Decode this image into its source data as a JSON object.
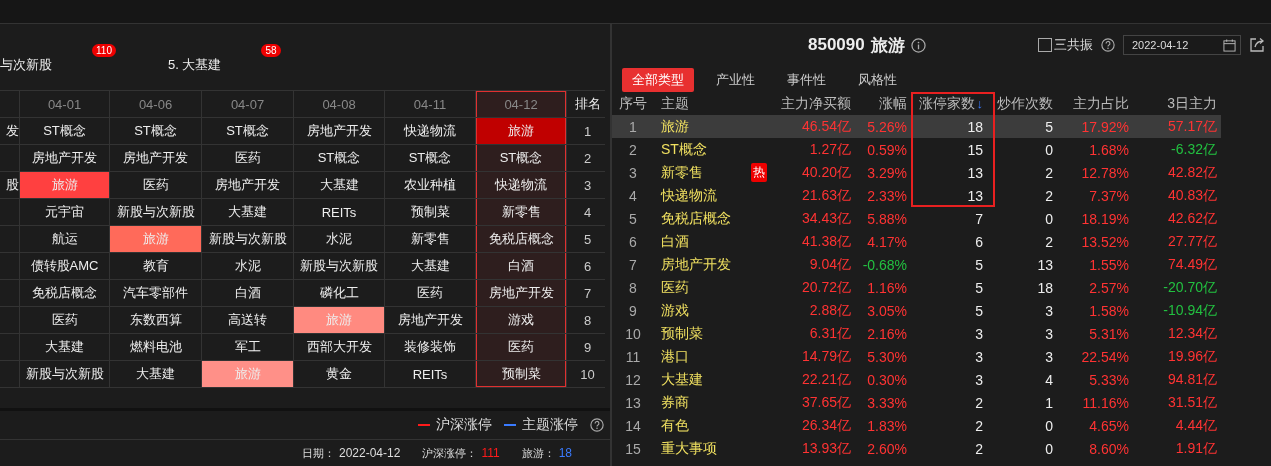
{
  "top_labels": [
    {
      "text": "与次新股",
      "badge": "110"
    },
    {
      "text": "5. 大基建",
      "badge": "58"
    }
  ],
  "history": {
    "columns": [
      {
        "label": "04-01",
        "selected": false
      },
      {
        "label": "04-06",
        "selected": false
      },
      {
        "label": "04-07",
        "selected": false
      },
      {
        "label": "04-08",
        "selected": false
      },
      {
        "label": "04-11",
        "selected": false
      },
      {
        "label": "04-12",
        "selected": true
      }
    ],
    "rank_header": "排名",
    "rows": [
      {
        "cut": "发",
        "rank": "1",
        "cells": [
          {
            "text": "ST概念"
          },
          {
            "text": "ST概念"
          },
          {
            "text": "ST概念"
          },
          {
            "text": "房地产开发"
          },
          {
            "text": "快递物流"
          },
          {
            "text": "旅游",
            "color": "#c00000"
          }
        ]
      },
      {
        "rank": "2",
        "cells": [
          {
            "text": "房地产开发"
          },
          {
            "text": "房地产开发"
          },
          {
            "text": "医药"
          },
          {
            "text": "ST概念"
          },
          {
            "text": "ST概念"
          },
          {
            "text": "ST概念"
          }
        ]
      },
      {
        "cut": "股",
        "rank": "3",
        "cells": [
          {
            "text": "旅游",
            "color": "#ff4040"
          },
          {
            "text": "医药"
          },
          {
            "text": "房地产开发"
          },
          {
            "text": "大基建"
          },
          {
            "text": "农业种植"
          },
          {
            "text": "快递物流"
          }
        ]
      },
      {
        "rank": "4",
        "cells": [
          {
            "text": "元宇宙"
          },
          {
            "text": "新股与次新股"
          },
          {
            "text": "大基建"
          },
          {
            "text": "REITs"
          },
          {
            "text": "预制菜"
          },
          {
            "text": "新零售"
          }
        ]
      },
      {
        "rank": "5",
        "cells": [
          {
            "text": "航运"
          },
          {
            "text": "旅游",
            "color": "#ff6a5a"
          },
          {
            "text": "新股与次新股"
          },
          {
            "text": "水泥"
          },
          {
            "text": "新零售"
          },
          {
            "text": "免税店概念"
          }
        ]
      },
      {
        "rank": "6",
        "cells": [
          {
            "text": "债转股AMC"
          },
          {
            "text": "教育"
          },
          {
            "text": "水泥"
          },
          {
            "text": "新股与次新股"
          },
          {
            "text": "大基建"
          },
          {
            "text": "白酒"
          }
        ]
      },
      {
        "rank": "7",
        "cells": [
          {
            "text": "免税店概念"
          },
          {
            "text": "汽车零部件"
          },
          {
            "text": "白酒"
          },
          {
            "text": "磷化工"
          },
          {
            "text": "医药"
          },
          {
            "text": "房地产开发"
          }
        ]
      },
      {
        "rank": "8",
        "cells": [
          {
            "text": "医药"
          },
          {
            "text": "东数西算"
          },
          {
            "text": "高送转"
          },
          {
            "text": "旅游",
            "color": "#ff8a80"
          },
          {
            "text": "房地产开发"
          },
          {
            "text": "游戏"
          }
        ]
      },
      {
        "rank": "9",
        "cells": [
          {
            "text": "大基建"
          },
          {
            "text": "燃料电池"
          },
          {
            "text": "军工"
          },
          {
            "text": "西部大开发"
          },
          {
            "text": "装修装饰"
          },
          {
            "text": "医药"
          }
        ]
      },
      {
        "rank": "10",
        "cells": [
          {
            "text": "新股与次新股"
          },
          {
            "text": "大基建"
          },
          {
            "text": "旅游",
            "color": "#ff9088"
          },
          {
            "text": "黄金"
          },
          {
            "text": "REITs"
          },
          {
            "text": "预制菜"
          }
        ]
      }
    ]
  },
  "legend": [
    {
      "label": "沪深涨停",
      "color": "#ff1a1a"
    },
    {
      "label": "主题涨停",
      "color": "#3a7bff"
    }
  ],
  "footer": [
    {
      "label": "日期：",
      "value": "2022-04-12",
      "color": "#dddddd"
    },
    {
      "label": "沪深涨停：",
      "value": "111",
      "color": "#ff1a1a"
    },
    {
      "label": "旅游：",
      "value": "18",
      "color": "#3a7bff"
    }
  ],
  "title": {
    "code": "850090",
    "name": "旅游"
  },
  "resonance": {
    "label": "三共振",
    "checked": false
  },
  "date_field": {
    "value": "2022-04-12"
  },
  "tabs": [
    {
      "label": "全部类型",
      "selected": true
    },
    {
      "label": "产业性",
      "selected": false
    },
    {
      "label": "事件性",
      "selected": false
    },
    {
      "label": "风格性",
      "selected": false
    }
  ],
  "table": {
    "columns": [
      {
        "label": "序号"
      },
      {
        "label": "主题"
      },
      {
        "label": "主力净买额"
      },
      {
        "label": "涨幅"
      },
      {
        "label": "涨停家数",
        "sort_mark": "↓",
        "outlined": true
      },
      {
        "label": "炒作次数"
      },
      {
        "label": "主力占比"
      },
      {
        "label": "3日主力"
      }
    ],
    "rows": [
      {
        "seq": "1",
        "theme": "旅游",
        "net": "46.54亿",
        "pct": "5.26%",
        "pct_down": false,
        "limit_up": "18",
        "hype": "5",
        "share": "17.92%",
        "three_day": "57.17亿",
        "three_day_down": false,
        "selected": true,
        "outlined": true
      },
      {
        "seq": "2",
        "theme": "ST概念",
        "net": "1.27亿",
        "pct": "0.59%",
        "pct_down": false,
        "limit_up": "15",
        "hype": "0",
        "share": "1.68%",
        "three_day": "-6.32亿",
        "three_day_down": true,
        "selected": false,
        "outlined": true
      },
      {
        "seq": "3",
        "theme": "新零售",
        "tag": "热",
        "net": "40.20亿",
        "pct": "3.29%",
        "pct_down": false,
        "limit_up": "13",
        "hype": "2",
        "share": "12.78%",
        "three_day": "42.82亿",
        "three_day_down": false,
        "selected": false,
        "outlined": true
      },
      {
        "seq": "4",
        "theme": "快递物流",
        "net": "21.63亿",
        "pct": "2.33%",
        "pct_down": false,
        "limit_up": "13",
        "hype": "2",
        "share": "7.37%",
        "three_day": "40.83亿",
        "three_day_down": false,
        "selected": false,
        "outlined": true
      },
      {
        "seq": "5",
        "theme": "免税店概念",
        "net": "34.43亿",
        "pct": "5.88%",
        "pct_down": false,
        "limit_up": "7",
        "hype": "0",
        "share": "18.19%",
        "three_day": "42.62亿",
        "three_day_down": false,
        "selected": false,
        "outlined": false
      },
      {
        "seq": "6",
        "theme": "白酒",
        "net": "41.38亿",
        "pct": "4.17%",
        "pct_down": false,
        "limit_up": "6",
        "hype": "2",
        "share": "13.52%",
        "three_day": "27.77亿",
        "three_day_down": false,
        "selected": false,
        "outlined": false
      },
      {
        "seq": "7",
        "theme": "房地产开发",
        "net": "9.04亿",
        "pct": "-0.68%",
        "pct_down": true,
        "limit_up": "5",
        "hype": "13",
        "share": "1.55%",
        "three_day": "74.49亿",
        "three_day_down": false,
        "selected": false,
        "outlined": false
      },
      {
        "seq": "8",
        "theme": "医药",
        "net": "20.72亿",
        "pct": "1.16%",
        "pct_down": false,
        "limit_up": "5",
        "hype": "18",
        "share": "2.57%",
        "three_day": "-20.70亿",
        "three_day_down": true,
        "selected": false,
        "outlined": false
      },
      {
        "seq": "9",
        "theme": "游戏",
        "net": "2.88亿",
        "pct": "3.05%",
        "pct_down": false,
        "limit_up": "5",
        "hype": "3",
        "share": "1.58%",
        "three_day": "-10.94亿",
        "three_day_down": true,
        "selected": false,
        "outlined": false
      },
      {
        "seq": "10",
        "theme": "预制菜",
        "net": "6.31亿",
        "pct": "2.16%",
        "pct_down": false,
        "limit_up": "3",
        "hype": "3",
        "share": "5.31%",
        "three_day": "12.34亿",
        "three_day_down": false,
        "selected": false,
        "outlined": false
      },
      {
        "seq": "11",
        "theme": "港口",
        "net": "14.79亿",
        "pct": "5.30%",
        "pct_down": false,
        "limit_up": "3",
        "hype": "3",
        "share": "22.54%",
        "three_day": "19.96亿",
        "three_day_down": false,
        "selected": false,
        "outlined": false
      },
      {
        "seq": "12",
        "theme": "大基建",
        "net": "22.21亿",
        "pct": "0.30%",
        "pct_down": false,
        "limit_up": "3",
        "hype": "4",
        "share": "5.33%",
        "three_day": "94.81亿",
        "three_day_down": false,
        "selected": false,
        "outlined": false
      },
      {
        "seq": "13",
        "theme": "券商",
        "net": "37.65亿",
        "pct": "3.33%",
        "pct_down": false,
        "limit_up": "2",
        "hype": "1",
        "share": "11.16%",
        "three_day": "31.51亿",
        "three_day_down": false,
        "selected": false,
        "outlined": false
      },
      {
        "seq": "14",
        "theme": "有色",
        "net": "26.34亿",
        "pct": "1.83%",
        "pct_down": false,
        "limit_up": "2",
        "hype": "0",
        "share": "4.65%",
        "three_day": "4.44亿",
        "three_day_down": false,
        "selected": false,
        "outlined": false
      },
      {
        "seq": "15",
        "theme": "重大事项",
        "net": "13.93亿",
        "pct": "2.60%",
        "pct_down": false,
        "limit_up": "2",
        "hype": "0",
        "share": "8.60%",
        "three_day": "1.91亿",
        "three_day_down": false,
        "selected": false,
        "outlined": false
      }
    ]
  }
}
